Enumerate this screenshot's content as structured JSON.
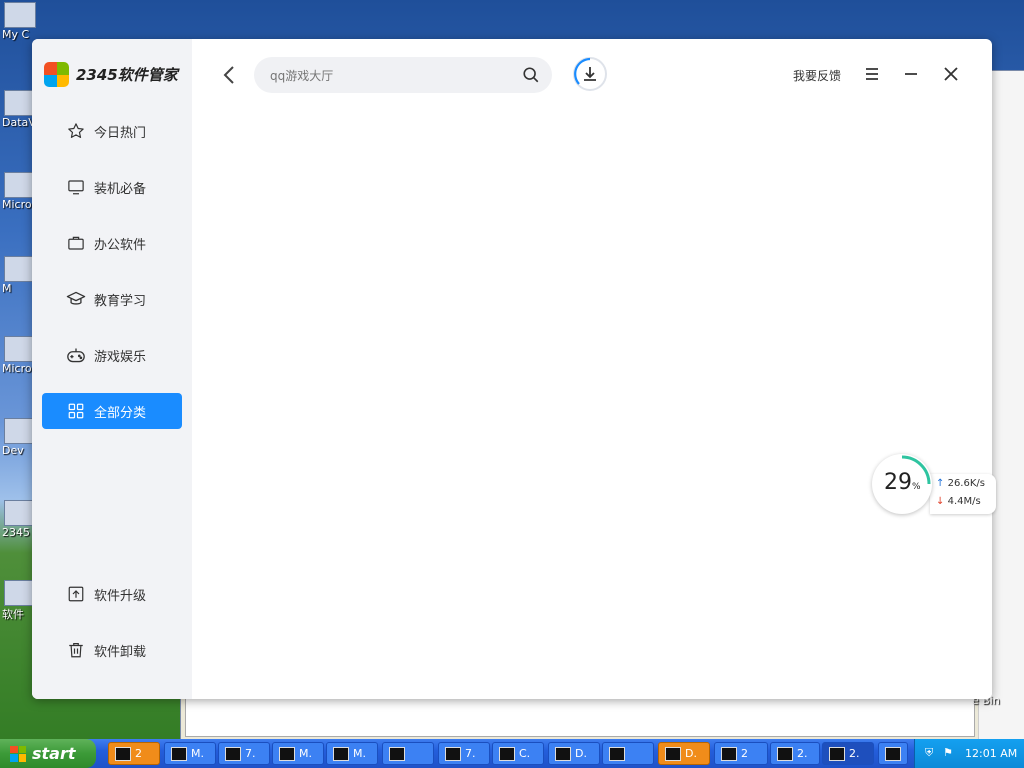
{
  "desktop": {
    "icons": [
      "My C",
      "DataV",
      "Micros C+",
      "M",
      "Micros Bas",
      "Dev",
      "2345",
      "软件"
    ],
    "recycle_label": "e Bin"
  },
  "app": {
    "logo_text": "2345软件管家",
    "search": {
      "placeholder": "qq游戏大厅"
    },
    "feedback_label": "我要反馈",
    "nav": [
      {
        "label": "今日热门",
        "icon": "star-icon",
        "active": false
      },
      {
        "label": "装机必备",
        "icon": "monitor-icon",
        "active": false
      },
      {
        "label": "办公软件",
        "icon": "briefcase-icon",
        "active": false
      },
      {
        "label": "教育学习",
        "icon": "graduation-cap-icon",
        "active": false
      },
      {
        "label": "游戏娱乐",
        "icon": "gamepad-icon",
        "active": false
      },
      {
        "label": "全部分类",
        "icon": "grid-icon",
        "active": true
      }
    ],
    "bottom_nav": [
      {
        "label": "软件升级",
        "icon": "upgrade-icon"
      },
      {
        "label": "软件卸载",
        "icon": "trash-icon"
      }
    ],
    "accent_color": "#1a8cff"
  },
  "speed_widget": {
    "percent": "29",
    "percent_sign": "%",
    "upload": "26.6K/s",
    "download": "4.4M/s"
  },
  "taskbar": {
    "start_label": "start",
    "buttons": [
      "2",
      "M.",
      "7.",
      "M.",
      "M.",
      "",
      "7.",
      "C.",
      "D.",
      "",
      "D.",
      "2",
      "2.",
      "2."
    ],
    "clock": "12:01 AM"
  }
}
